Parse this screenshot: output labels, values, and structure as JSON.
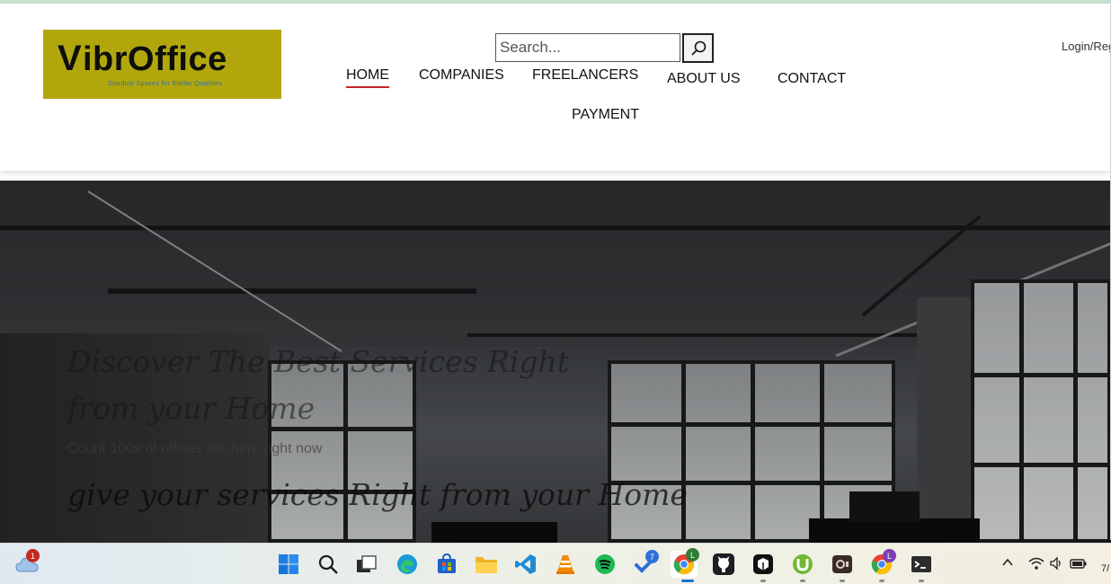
{
  "brand": {
    "logo_v": "V",
    "logo_rest": "ibrOffice",
    "tagline": "Stardust Spaces for Stellar Qualities"
  },
  "search": {
    "placeholder": "Search..."
  },
  "nav": {
    "home": "HOME",
    "companies": "COMPANIES",
    "freelancers": "FREELANCERS",
    "about": "ABOUT US",
    "contact": "CONTACT",
    "payment": "PAYMENT"
  },
  "auth": {
    "login": "Login/Reg"
  },
  "hero": {
    "title": "Discover The Best Services Right from your Home",
    "subtitle": "Count 100s of offices are here right now",
    "title2": "give your services Right from your Home"
  },
  "taskbar": {
    "weather_badge": "1",
    "todo_badge": "7",
    "chrome_profile_badge": "L",
    "chrome2_profile_badge": "L",
    "clock_fragment": "7/"
  },
  "colors": {
    "accent_underline": "#c0262d",
    "logo_bg": "#b1a70d"
  }
}
